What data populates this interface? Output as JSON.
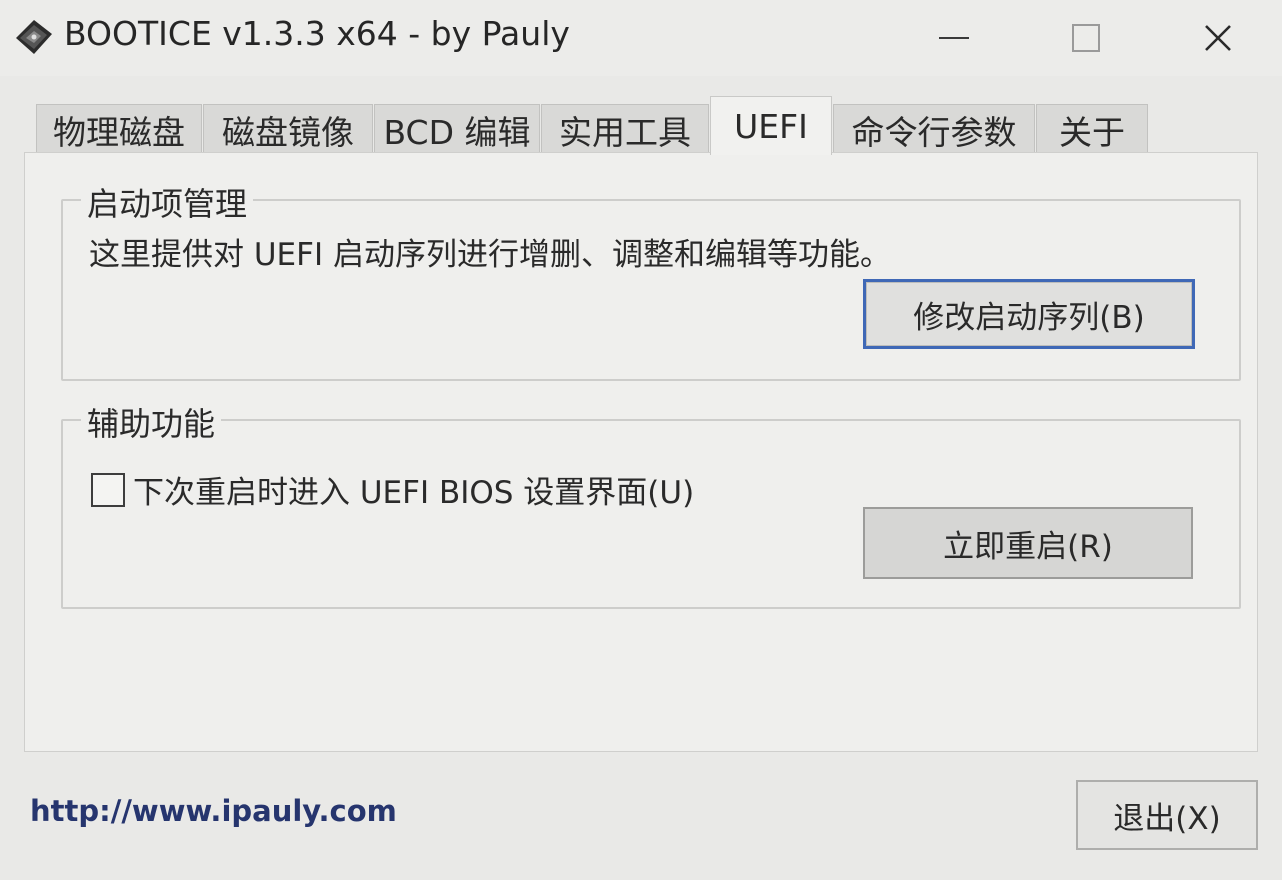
{
  "window": {
    "title": "BOOTICE v1.3.3 x64 - by Pauly",
    "close_glyph": "✕",
    "accent_color": "#3f68b6"
  },
  "tabs": [
    {
      "label": "物理磁盘"
    },
    {
      "label": "磁盘镜像"
    },
    {
      "label": "BCD 编辑"
    },
    {
      "label": "实用工具"
    },
    {
      "label": "UEFI",
      "active": true
    },
    {
      "label": "命令行参数"
    },
    {
      "label": "关于"
    }
  ],
  "boot_group": {
    "title": "启动项管理",
    "description": "这里提供对 UEFI 启动序列进行增删、调整和编辑等功能。",
    "modify_button": "修改启动序列(B)"
  },
  "aux_group": {
    "title": "辅助功能",
    "checkbox_label": "下次重启时进入 UEFI BIOS 设置界面(U)",
    "checkbox_checked": false,
    "restart_button": "立即重启(R)"
  },
  "footer": {
    "link": "http://www.ipauly.com",
    "exit_button": "退出(X)"
  }
}
